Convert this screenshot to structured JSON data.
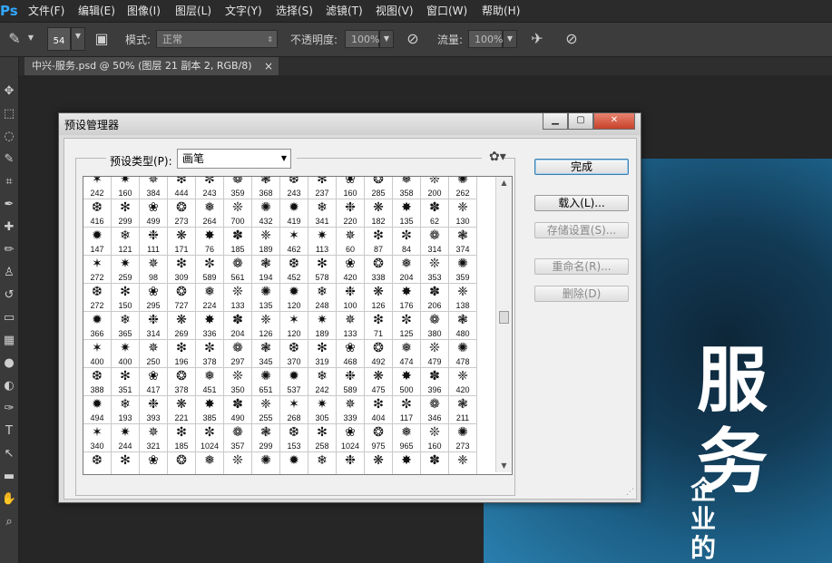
{
  "app": {
    "logo": "Ps",
    "menu": [
      "文件(F)",
      "编辑(E)",
      "图像(I)",
      "图层(L)",
      "文字(Y)",
      "选择(S)",
      "滤镜(T)",
      "视图(V)",
      "窗口(W)",
      "帮助(H)"
    ]
  },
  "options_bar": {
    "brush_size": "54",
    "mode_label": "模式:",
    "mode_value": "正常",
    "opacity_label": "不透明度:",
    "opacity_value": "100%",
    "flow_label": "流量:",
    "flow_value": "100%",
    "icons": [
      "brush-tool-icon",
      "brush-panel-icon",
      "pressure-opacity-icon",
      "airbrush-icon",
      "pressure-size-icon"
    ]
  },
  "document_tab": {
    "title": "中兴-服务.psd @ 50% (图层 21 副本 2, RGB/8)",
    "close": "×"
  },
  "tools": [
    "move-icon",
    "marquee-icon",
    "lasso-icon",
    "quick-select-icon",
    "crop-icon",
    "eyedropper-icon",
    "healing-icon",
    "brush-icon",
    "stamp-icon",
    "history-brush-icon",
    "eraser-icon",
    "gradient-icon",
    "blur-icon",
    "dodge-icon",
    "pen-icon",
    "type-icon",
    "path-select-icon",
    "shape-icon",
    "hand-icon",
    "zoom-icon"
  ],
  "tool_glyphs": [
    "✥",
    "⬚",
    "◌",
    "✎",
    "⌗",
    "✒",
    "✚",
    "✏",
    "♙",
    "↺",
    "▭",
    "▦",
    "●",
    "◐",
    "✑",
    "T",
    "↖",
    "▬",
    "✋",
    "⌕"
  ],
  "artwork": {
    "title": "服务",
    "subtitle": "企业的"
  },
  "dialog": {
    "title": "预设管理器",
    "preset_type_label": "预设类型(P):",
    "preset_type_value": "画笔",
    "buttons": {
      "done": "完成",
      "load": "载入(L)...",
      "save": "存储设置(S)...",
      "rename": "重命名(R)...",
      "delete": "删除(D)"
    },
    "brush_sizes": [
      [
        "242",
        "160",
        "384",
        "444",
        "243",
        "359",
        "368",
        "243",
        "237",
        "160",
        "285",
        "358",
        "200",
        "262"
      ],
      [
        "416",
        "299",
        "499",
        "273",
        "264",
        "700",
        "432",
        "419",
        "341",
        "220",
        "182",
        "135",
        "62",
        "130"
      ],
      [
        "147",
        "121",
        "111",
        "171",
        "76",
        "185",
        "189",
        "462",
        "113",
        "60",
        "87",
        "84",
        "314",
        "374"
      ],
      [
        "272",
        "259",
        "98",
        "309",
        "589",
        "561",
        "194",
        "452",
        "578",
        "420",
        "338",
        "204",
        "353",
        "359"
      ],
      [
        "272",
        "150",
        "295",
        "727",
        "224",
        "133",
        "135",
        "120",
        "248",
        "100",
        "126",
        "176",
        "206",
        "138"
      ],
      [
        "366",
        "365",
        "314",
        "269",
        "336",
        "204",
        "126",
        "120",
        "189",
        "133",
        "71",
        "125",
        "380",
        "480"
      ],
      [
        "400",
        "400",
        "250",
        "196",
        "378",
        "297",
        "345",
        "370",
        "319",
        "468",
        "492",
        "474",
        "479",
        "478"
      ],
      [
        "388",
        "351",
        "417",
        "378",
        "451",
        "350",
        "651",
        "537",
        "242",
        "589",
        "475",
        "500",
        "396",
        "420"
      ],
      [
        "494",
        "193",
        "393",
        "221",
        "385",
        "490",
        "255",
        "268",
        "305",
        "339",
        "404",
        "117",
        "346",
        "211"
      ],
      [
        "340",
        "244",
        "321",
        "185",
        "1024",
        "357",
        "299",
        "153",
        "258",
        "1024",
        "975",
        "965",
        "160",
        "273"
      ],
      [
        "",
        "",
        "",
        "",
        "",
        "",
        "",
        "",
        "",
        "",
        "",
        "",
        "",
        ""
      ]
    ],
    "brush_glyphs": [
      "✶",
      "❋",
      "✺",
      "❀",
      "❁",
      "✷",
      "✸",
      "✹",
      "❂",
      "❃",
      "✵",
      "✽",
      "❄",
      "❅",
      "❆",
      "❇",
      "❈",
      "❉",
      "❊",
      "✻",
      "✼"
    ]
  },
  "colors": {
    "ps_blue": "#31a8ff",
    "dialog_bg": "#f0f0f0",
    "artboard_blue": "#1c5f86"
  }
}
